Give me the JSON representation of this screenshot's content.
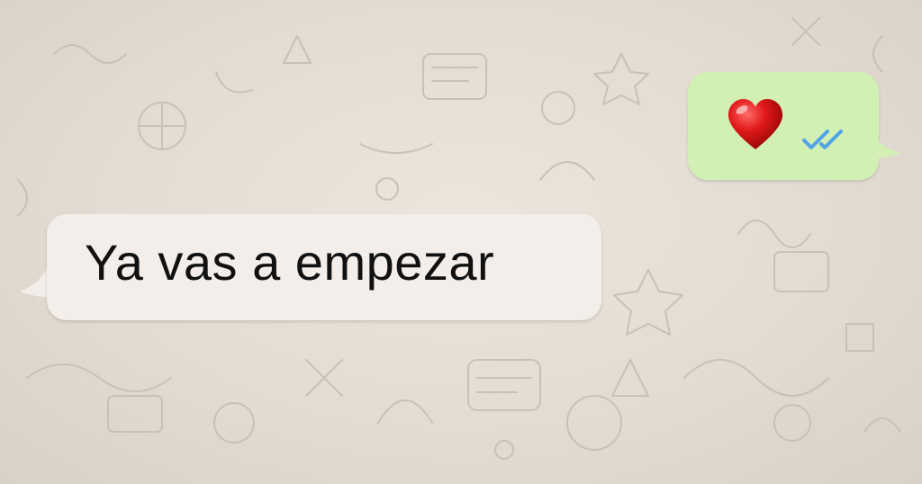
{
  "conversation": {
    "outgoing_message": {
      "content_icon": "red-heart-emoji",
      "status_icon": "double-check-read-icon",
      "bubble_color": "#d3f0b4",
      "status_color": "#4fa3e6"
    },
    "incoming_message": {
      "text": "Ya vas a empezar",
      "bubble_color": "#f3eeea"
    }
  }
}
